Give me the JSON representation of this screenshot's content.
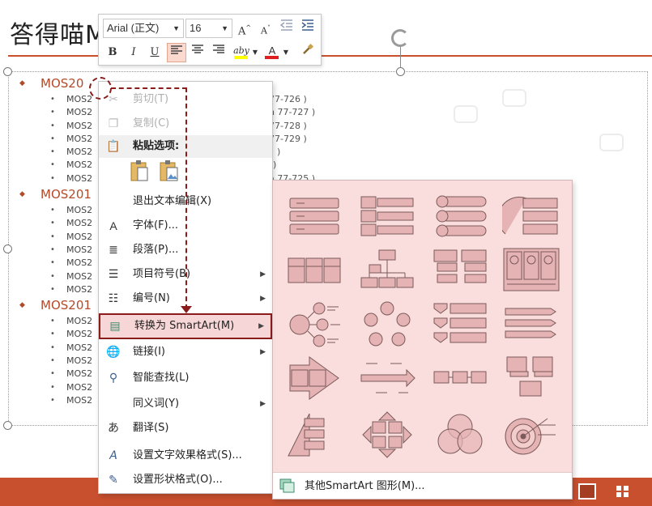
{
  "slide": {
    "title": "答得喵MO",
    "outline": [
      {
        "heading": "MOS20",
        "items": [
          "MOS2",
          "MOS2",
          "MOS2",
          "MOS2",
          "MOS2",
          "MOS2",
          "MOS2"
        ]
      },
      {
        "heading": "MOS201",
        "items": [
          "MOS2",
          "MOS2",
          "MOS2",
          "MOS2",
          "MOS2",
          "MOS2",
          "MOS2"
        ]
      },
      {
        "heading": "MOS201",
        "items": [
          "MOS2",
          "MOS2",
          "MOS2",
          "MOS2",
          "MOS2",
          "MOS2",
          "MOS2"
        ]
      }
    ],
    "partial_suffixes": [
      "77-726 )",
      "n 77-727 )",
      "77-728 )",
      "77-729 )",
      ")",
      "l)",
      "a 77-725 )"
    ]
  },
  "mini_toolbar": {
    "font_name": "Arial (正文)",
    "font_size": "16",
    "grow_font": "A",
    "shrink_font": "A",
    "bold": "B",
    "italic": "I",
    "underline": "U",
    "highlight_label": "aby",
    "font_color_label": "A",
    "highlight_color": "#ffff00",
    "font_color": "#e02020"
  },
  "context_menu": {
    "items": [
      {
        "label": "剪切(T)",
        "icon": "scissors-icon",
        "enabled": false
      },
      {
        "label": "复制(C)",
        "icon": "copy-icon",
        "enabled": false
      },
      {
        "label": "粘贴选项:",
        "icon": "paste-icon",
        "enabled": true
      },
      {
        "label": "退出文本编辑(X)",
        "icon": "",
        "enabled": true
      },
      {
        "label": "字体(F)...",
        "icon": "font-icon",
        "enabled": true
      },
      {
        "label": "段落(P)...",
        "icon": "paragraph-icon",
        "enabled": true
      },
      {
        "label": "项目符号(B)",
        "icon": "bullets-icon",
        "enabled": true
      },
      {
        "label": "编号(N)",
        "icon": "numbering-icon",
        "enabled": true
      },
      {
        "label": "转换为 SmartArt(M)",
        "icon": "smartart-icon",
        "enabled": true
      },
      {
        "label": "链接(I)",
        "icon": "link-icon",
        "enabled": true
      },
      {
        "label": "智能查找(L)",
        "icon": "smart-lookup-icon",
        "enabled": true
      },
      {
        "label": "同义词(Y)",
        "icon": "",
        "enabled": true
      },
      {
        "label": "翻译(S)",
        "icon": "translate-icon",
        "enabled": true
      },
      {
        "label": "设置文字效果格式(S)...",
        "icon": "text-effects-icon",
        "enabled": true
      },
      {
        "label": "设置形状格式(O)...",
        "icon": "shape-format-icon",
        "enabled": true
      }
    ]
  },
  "smartart_gallery": {
    "more_label": "其他SmartArt 图形(M)..."
  },
  "colors": {
    "accent": "#c9502f",
    "highlight_border": "#8b1c1c",
    "gallery_bg": "#fadede"
  }
}
